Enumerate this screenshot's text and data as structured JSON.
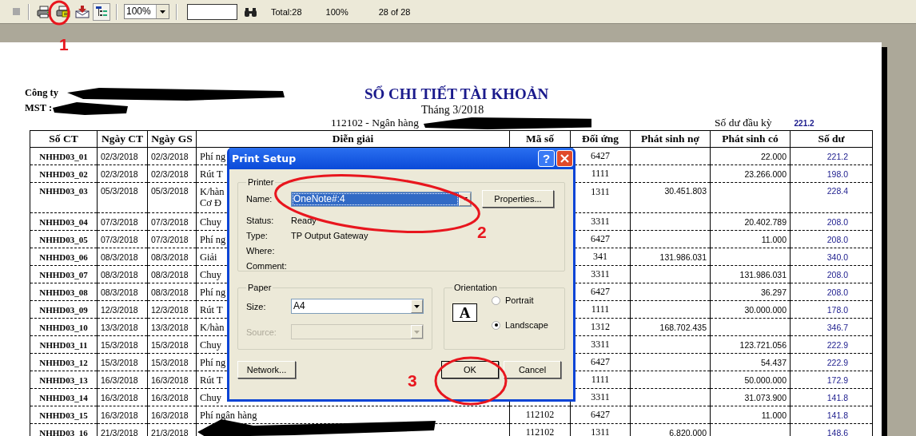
{
  "toolbar": {
    "zoom": "100%",
    "total": "Total:28",
    "percent": "100%",
    "pages": "28 of 28"
  },
  "report": {
    "company": "Công ty",
    "tax_id": "MST :",
    "title": "SỔ CHI TIẾT TÀI KHOẢN",
    "period": "Tháng 3/2018",
    "account": "112102 - Ngân hàng",
    "opening_label": "Số dư đầu kỳ",
    "opening_value": "221.2",
    "columns": [
      "Số CT",
      "Ngày CT",
      "Ngày GS",
      "Diễn giải",
      "Mã số",
      "Đối ứng",
      "Phát sinh nợ",
      "Phát sinh có",
      "Số dư"
    ],
    "rows": [
      {
        "code": "NHHD03_01",
        "date_ct": "02/3/2018",
        "date_gs": "02/3/2018",
        "desc": "Phí ng",
        "contra": "6427",
        "credit": "22.000",
        "balance": "221.2"
      },
      {
        "code": "NHHD03_02",
        "date_ct": "02/3/2018",
        "date_gs": "02/3/2018",
        "desc": "Rút T",
        "contra": "1111",
        "credit": "23.266.000",
        "balance": "198.0"
      },
      {
        "code": "NHHD03_03",
        "date_ct": "05/3/2018",
        "date_gs": "05/3/2018",
        "desc": "K/hàn\nCơ Đ",
        "contra": "1311",
        "debit": "30.451.803",
        "balance": "228.4"
      },
      {
        "code": "NHHD03_04",
        "date_ct": "07/3/2018",
        "date_gs": "07/3/2018",
        "desc": "Chuy",
        "contra": "3311",
        "credit": "20.402.789",
        "balance": "208.0"
      },
      {
        "code": "NHHD03_05",
        "date_ct": "07/3/2018",
        "date_gs": "07/3/2018",
        "desc": "Phí ng",
        "contra": "6427",
        "credit": "11.000",
        "balance": "208.0"
      },
      {
        "code": "NHHD03_06",
        "date_ct": "08/3/2018",
        "date_gs": "08/3/2018",
        "desc": "Giải",
        "contra": "341",
        "debit": "131.986.031",
        "balance": "340.0"
      },
      {
        "code": "NHHD03_07",
        "date_ct": "08/3/2018",
        "date_gs": "08/3/2018",
        "desc": "Chuy",
        "contra": "3311",
        "credit": "131.986.031",
        "balance": "208.0"
      },
      {
        "code": "NHHD03_08",
        "date_ct": "08/3/2018",
        "date_gs": "08/3/2018",
        "desc": "Phí ng",
        "contra": "6427",
        "credit": "36.297",
        "balance": "208.0"
      },
      {
        "code": "NHHD03_09",
        "date_ct": "12/3/2018",
        "date_gs": "12/3/2018",
        "desc": "Rút T",
        "contra": "1111",
        "credit": "30.000.000",
        "balance": "178.0"
      },
      {
        "code": "NHHD03_10",
        "date_ct": "13/3/2018",
        "date_gs": "13/3/2018",
        "desc": "K/hàn",
        "contra": "1312",
        "debit": "168.702.435",
        "balance": "346.7"
      },
      {
        "code": "NHHD03_11",
        "date_ct": "15/3/2018",
        "date_gs": "15/3/2018",
        "desc": "Chuy",
        "contra": "3311",
        "credit": "123.721.056",
        "balance": "222.9"
      },
      {
        "code": "NHHD03_12",
        "date_ct": "15/3/2018",
        "date_gs": "15/3/2018",
        "desc": "Phí ng",
        "contra": "6427",
        "credit": "54.437",
        "balance": "222.9"
      },
      {
        "code": "NHHD03_13",
        "date_ct": "16/3/2018",
        "date_gs": "16/3/2018",
        "desc": "Rút T",
        "contra": "1111",
        "credit": "50.000.000",
        "balance": "172.9"
      },
      {
        "code": "NHHD03_14",
        "date_ct": "16/3/2018",
        "date_gs": "16/3/2018",
        "desc": "Chuy",
        "contra": "3311",
        "credit": "31.073.900",
        "balance": "141.8"
      },
      {
        "code": "NHHD03_15",
        "date_ct": "16/3/2018",
        "date_gs": "16/3/2018",
        "desc": "Phí ngân hàng",
        "account": "112102",
        "contra": "6427",
        "credit": "11.000",
        "balance": "141.8"
      },
      {
        "code": "NHHD03_16",
        "date_ct": "21/3/2018",
        "date_gs": "21/3/2018",
        "account": "112102",
        "contra": "1311",
        "debit": "6.820.000",
        "balance": "148.6"
      }
    ]
  },
  "dialog": {
    "title": "Print Setup",
    "help": "?",
    "printer": {
      "label": "Printer",
      "name_label": "Name:",
      "name": "OneNote#:4",
      "properties": "Properties...",
      "info": [
        {
          "label": "Status:",
          "value": "Ready"
        },
        {
          "label": "Type:",
          "value": "TP Output Gateway"
        },
        {
          "label": "Where:"
        },
        {
          "label": "Comment:"
        }
      ]
    },
    "paper": {
      "label": "Paper",
      "size_label": "Size:",
      "size": "A4",
      "source_label": "Source:",
      "source_disabled": true
    },
    "orientation": {
      "label": "Orientation",
      "glyph": "A",
      "options": [
        {
          "label": "Portrait",
          "selected": false
        },
        {
          "label": "Landscape",
          "selected": true
        }
      ]
    },
    "buttons": [
      "Network...",
      "OK",
      "Cancel"
    ]
  },
  "annotations": [
    {
      "number": "1"
    },
    {
      "number": "2"
    },
    {
      "number": "3"
    }
  ]
}
